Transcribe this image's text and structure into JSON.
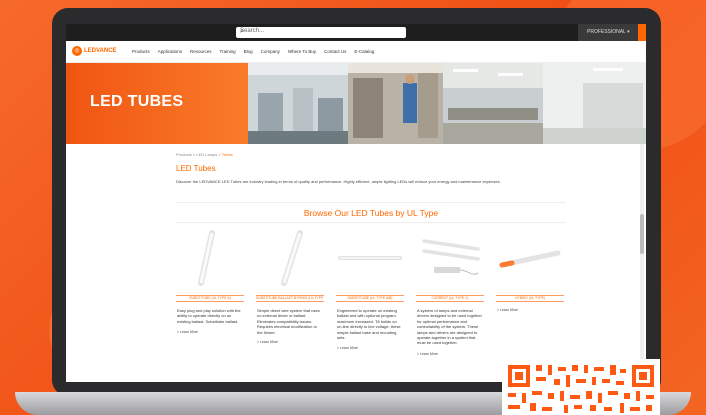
{
  "background": {
    "accent": "#f4581c"
  },
  "topbar": {
    "search_placeholder": "Search...",
    "profile_label": "PROFESSIONAL ▾"
  },
  "nav": {
    "logo_text": "LEDVANCE",
    "items": [
      "Products",
      "Applications",
      "Resources",
      "Training",
      "Blog",
      "Company",
      "Where To Buy",
      "Contact Us",
      "E-Catalog"
    ]
  },
  "hero": {
    "title": "LED TUBES"
  },
  "breadcrumb": {
    "items": [
      "Products",
      "LED Lamps"
    ],
    "current": "Tubes"
  },
  "page": {
    "heading": "LED Tubes",
    "description": "Discover the LEDVANCE LED Tubes are industry leading in terms of quality and performance. Highly efficient, ample lighting LEDs will reduce your energy and maintenance expenses."
  },
  "section": {
    "title": "Browse Our LED Tubes by UL Type"
  },
  "cards": [
    {
      "title": "SUBSTITUBE (UL TYPE A)",
      "body": "Easy plug and play solution with the ability to operate directly on an existing ballast. Substitube ballast.",
      "link": "> Learn More"
    },
    {
      "title": "SUBSTITUBE BALLAST BYPASS (UL TYPE B)",
      "body": "Simple direct wire system that uses no external driver or ballast. Eliminates compatibility issues. Requires electrical modification to the fixture.",
      "link": "> Learn More"
    },
    {
      "title": "SUBSTITUBE (UL TYPE A/B)",
      "body": "Engineered to operate on existing ballast and with optional program maximum increased. T8 builds on on-line directly to line voltage, these simple ballast base and mounting sets.",
      "link": "> Learn More"
    },
    {
      "title": "CURRENT (UL TYPE C)",
      "body": "A system of lamps and external drivers designed to be used together for optimal performance and controllability of the system. These lamps and drivers are designed to operate together in a system that must be used together.",
      "link": "> Learn More"
    },
    {
      "title": "HYBRID (UL TYPE)",
      "body": "",
      "link": "> Learn More"
    }
  ],
  "qr": {
    "color": "#ff5a14"
  }
}
